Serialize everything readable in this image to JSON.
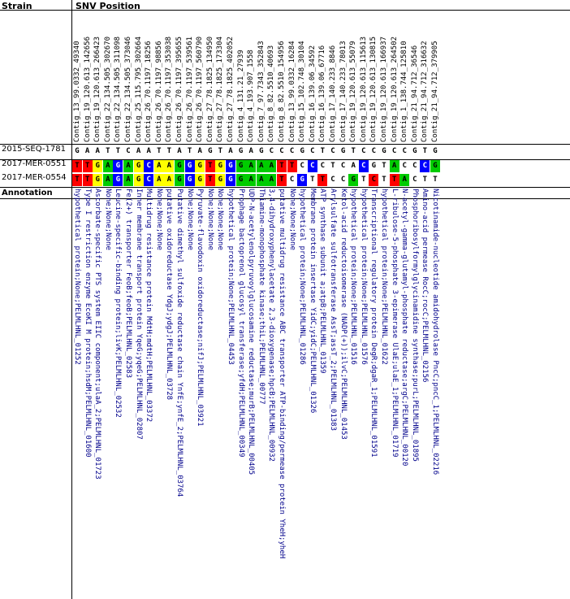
{
  "header": {
    "strain": "Strain",
    "snv_position": "SNV Position",
    "annotation": "Annotation"
  },
  "strains": [
    "2015-SEQ-1781",
    "2017-MER-0551",
    "2017-MER-0554"
  ],
  "positions": [
    "Contig_13_99.0332_49340",
    "Contig_19_120.613_142656",
    "Contig_19_120.613_266423",
    "Contig_22_134.505_302670",
    "Contig_22_134.505_311098",
    "Contig_22_134.505_373046",
    "Contig_25_115.795_302664",
    "Contig_26_70.1197_18256",
    "Contig_26_70.1197_98856",
    "Contig_26_70.1197_353038",
    "Contig_26_70.1197_395655",
    "Contig_26_70.1197_539561",
    "Contig_26_70.1197_560790",
    "Contig_27_78.1825_134950",
    "Contig_27_78.1825_173304",
    "Contig_27_78.1825_402052",
    "Contig_4_131.21_27939",
    "Contig_4_193.907_1558",
    "Contig_7_97.7343_352843",
    "Contig_8_82.5510_40693",
    "Contig_8_82.5510_154956",
    "Contig_13_99.0332_16284",
    "Contig_15_102.748_30104",
    "Contig_16_139.06_34592",
    "Contig_16_139.06_67716",
    "Contig_17_140.233_8846",
    "Contig_17_140.233_78013",
    "Contig_19_120.613_55079",
    "Contig_19_120.613_115613",
    "Contig_19_120.613_130815",
    "Contig_19_120.613_166937",
    "Contig_19_120.613_264502",
    "Contig_1_138.744_125810",
    "Contig_21_94.712_36546",
    "Contig_21_94.712_316632",
    "Contig_21_94.712_379905"
  ],
  "reference": [
    "G",
    "A",
    "A",
    "T",
    "T",
    "C",
    "A",
    "A",
    "T",
    "T",
    "A",
    "T",
    "A",
    "G",
    "T",
    "A",
    "G",
    "A",
    "G",
    "C",
    "C",
    "C",
    "G",
    "C",
    "T",
    "C",
    "G",
    "T",
    "C",
    "C",
    "G",
    "C",
    "C",
    "G",
    "T",
    "G"
  ],
  "variants": [
    [
      "T",
      "T",
      "G",
      "A",
      "G",
      "A",
      "G",
      "C",
      "A",
      "A",
      "G",
      "G",
      "G",
      "T",
      "G",
      "G",
      "G",
      "A",
      "A",
      "A",
      "T",
      "T",
      "C",
      "C",
      "C",
      "T",
      "C",
      "A",
      "C",
      "G",
      "T",
      "A",
      "C",
      "C",
      "C",
      "G"
    ],
    [
      "T",
      "T",
      "G",
      "A",
      "G",
      "A",
      "G",
      "C",
      "A",
      "A",
      "G",
      "G",
      "G",
      "T",
      "G",
      "G",
      "G",
      "A",
      "A",
      "A",
      "T",
      "C",
      "G",
      "T",
      "T",
      "C",
      "C",
      "G",
      "T",
      "C",
      "T",
      "T",
      "A",
      "C",
      "T",
      "T"
    ]
  ],
  "variant_colors": {
    "0": [
      "#ff0000",
      "#ff0000",
      "#ffff00",
      "#00cc00",
      "#0000ff",
      "#00cc00",
      "#ffff00",
      "#0000ff",
      "#ffff00",
      "#ffff00",
      "#00cc00",
      "#0000ff",
      "#ffff00",
      "#ff0000",
      "#ffff00",
      "#0000ff",
      "#00cc00",
      "#00cc00",
      "#00cc00",
      "#00cc00",
      "#ff0000",
      "#ff0000",
      "#ffffff",
      "#0000ff",
      "#ffffff",
      "#ffffff",
      "#ffffff",
      "#ffffff",
      "#0000ff",
      "#ffffff",
      "#ffffff",
      "#00cc00",
      "#ffffff",
      "#ffffff",
      "#0000ff",
      "#00cc00"
    ],
    "1": [
      "#ff0000",
      "#ff0000",
      "#ffff00",
      "#00cc00",
      "#0000ff",
      "#00cc00",
      "#ffff00",
      "#0000ff",
      "#ffff00",
      "#ffff00",
      "#00cc00",
      "#0000ff",
      "#ffff00",
      "#ff0000",
      "#ffff00",
      "#0000ff",
      "#00cc00",
      "#00cc00",
      "#00cc00",
      "#00cc00",
      "#ff0000",
      "#ffffff",
      "#0000ff",
      "#ffffff",
      "#ff0000",
      "#ffffff",
      "#ffffff",
      "#00cc00",
      "#ffffff",
      "#ff0000",
      "#ffffff",
      "#ff0000",
      "#00cc00",
      "#ffffff",
      "#ffffff",
      "#ffffff"
    ]
  },
  "annotations": [
    "hypothetical protein;None;PELMLHNL_01252",
    "Type I restriction enzyme EcoKI M protein;hsdM;PELMLHNL_01600",
    "Ascorbate-specific PTS system EIIC component;ulaA_2;PELMLHNL_01723",
    "None;None;None",
    "Leucine-specific-binding protein;livK;PELMLHNL_02532",
    "Fe(2+) transporter FeoB;feoB;PELMLHNL_02583",
    "Inner membrane transport protein YqeG;yqeG;PELMLHNL_02807",
    "Multidrug resistance protein MdtH;mdtH;PELMLHNL_03372",
    "None;None;None",
    "putative oxidoreductase YdgJ;ydgJ;PELMLHNL_03728",
    "Putative dimethyl sulfoxide reductase chain YnfE;ynfE_2;PELMLHNL_03764",
    "None;None;None",
    "Pyruvate-flavodoxin oxidoreductase;nifJ;PELMLHNL_03921",
    "None;None;None",
    "None;None;None",
    "hypothetical protein;None;PELMLHNL_04453",
    "Prophage bactoprenol glucosyl transferase;yfdH;PELMLHNL_00349",
    "UDP-N-acetylenolpyruvoylglucosamine reductase;murB;PELMLHNL_00405",
    "Thiamine-monophosphate kinase;thiL;PELMLHNL_00777",
    "3,4-dihydroxyphenylacetate 2,3-dioxygenase;hpcB;PELMLHNL_00932",
    "putative multidrug resistance ABC transporter ATP-binding/permease protein YheH;yheH",
    "None;None;None",
    "hypothetical protein;None;PELMLHNL_01286",
    "Membrane protein insertase YidC;yidC;PELMLHNL_01326",
    "ATP synthase subunit a;atpB;PELMLHNL_01359",
    "Arylsulfate sulfotransferase AssT;assT_2;PELMLHNL_01383",
    "Ketol-acid reductoisomerase (NADP(+));ilvC;PELMLHNL_01453",
    "hypothetical protein;None;PELMLHNL_01516",
    "hypothetical protein;None;PELMLHNL_01576",
    "Transcriptional regulatory protein DegR;dgaR_1;PELMLHNL_01591",
    "hypothetical protein;None;PELMLHNL_01622",
    "L-ribulose-5-phosphate 3-epimerase UlaE;ulaE_1;PELMLHNL_01719",
    "N-acetyl-gamma-glutamyl-phosphate reductase;argC;PELMLHNL_00120",
    "Phosphoribosylformylglycinamidine synthase;purL;PELMLHNL_01895",
    "Amino-acid permease RocC;rocC;PELMLHNL_02156",
    "Nicotinamide-nucleotide amidohydrolase PncC;pncC_1;PELMLHNL_02216"
  ]
}
